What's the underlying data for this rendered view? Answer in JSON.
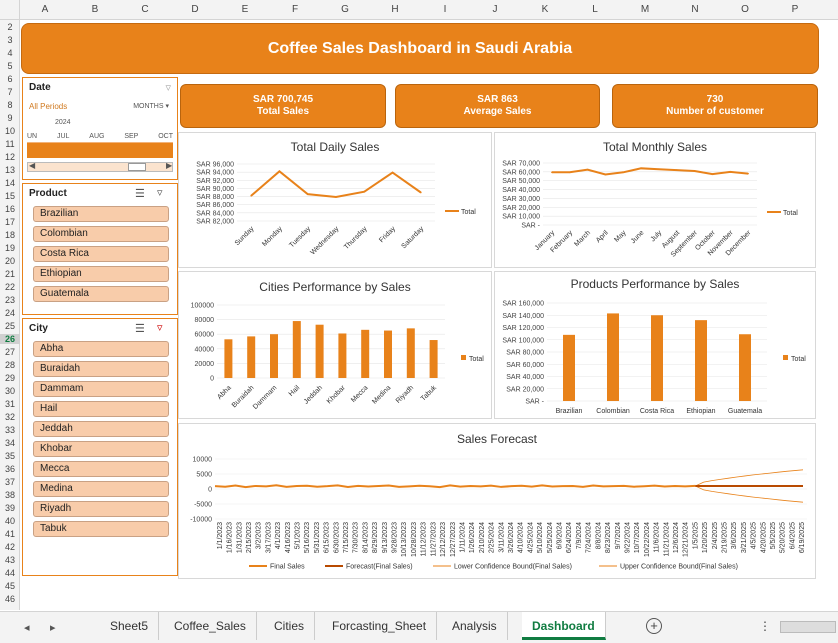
{
  "columns": [
    "A",
    "B",
    "C",
    "D",
    "E",
    "F",
    "G",
    "H",
    "I",
    "J",
    "K",
    "L",
    "M",
    "N",
    "O",
    "P"
  ],
  "rows": [
    "2",
    "3",
    "4",
    "5",
    "6",
    "7",
    "8",
    "9",
    "10",
    "11",
    "12",
    "13",
    "14",
    "15",
    "16",
    "17",
    "18",
    "19",
    "20",
    "21",
    "22",
    "23",
    "24",
    "25",
    "26",
    "27",
    "28",
    "29",
    "30",
    "31",
    "32",
    "33",
    "34",
    "35",
    "36",
    "37",
    "38",
    "39",
    "40",
    "41",
    "42",
    "43",
    "44",
    "45",
    "46"
  ],
  "selected_row": "26",
  "banner": {
    "title": "Coffee Sales Dashboard in Saudi Arabia"
  },
  "date_slicer": {
    "header": "Date",
    "period": "All Periods",
    "granularity": "MONTHS",
    "year": "2024",
    "months": [
      "UN",
      "JUL",
      "AUG",
      "SEP",
      "OCT"
    ]
  },
  "product_slicer": {
    "header": "Product",
    "items": [
      "Brazilian",
      "Colombian",
      "Costa Rica",
      "Ethiopian",
      "Guatemala"
    ]
  },
  "city_slicer": {
    "header": "City",
    "items": [
      "Abha",
      "Buraidah",
      "Dammam",
      "Hail",
      "Jeddah",
      "Khobar",
      "Mecca",
      "Medina",
      "Riyadh",
      "Tabuk"
    ]
  },
  "kpis": [
    {
      "value": "SAR 700,745",
      "label": "Total Sales"
    },
    {
      "value": "SAR 863",
      "label": "Average Sales"
    },
    {
      "value": "730",
      "label": "Number of customer"
    }
  ],
  "colors": {
    "accent": "#e8821a",
    "slicer_button": "#f8ccaa",
    "active_tab": "#107c41"
  },
  "chart_data": [
    {
      "id": "daily",
      "type": "line",
      "title": "Total Daily Sales",
      "categories": [
        "Sunday",
        "Monday",
        "Tuesday",
        "Wednesday",
        "Thursday",
        "Friday",
        "Saturday"
      ],
      "series": [
        {
          "name": "Total",
          "values": [
            88200,
            94200,
            88600,
            87900,
            89200,
            93900,
            89000
          ]
        }
      ],
      "ylim": [
        82000,
        96000
      ],
      "yticks": [
        82000,
        84000,
        86000,
        88000,
        90000,
        92000,
        94000,
        96000
      ],
      "ytick_labels": [
        "SAR 82,000",
        "SAR 84,000",
        "SAR 86,000",
        "SAR 88,000",
        "SAR 90,000",
        "SAR 92,000",
        "SAR 94,000",
        "SAR 96,000"
      ],
      "legend": "right"
    },
    {
      "id": "monthly",
      "type": "line",
      "title": "Total Monthly Sales",
      "categories": [
        "January",
        "February",
        "March",
        "April",
        "May",
        "June",
        "July",
        "August",
        "September",
        "October",
        "November",
        "December"
      ],
      "series": [
        {
          "name": "Total",
          "values": [
            59500,
            59500,
            62500,
            57000,
            59500,
            64000,
            63000,
            62000,
            61000,
            57500,
            60000,
            58000
          ]
        }
      ],
      "ylim": [
        0,
        70000
      ],
      "yticks": [
        0,
        10000,
        20000,
        30000,
        40000,
        50000,
        60000,
        70000
      ],
      "ytick_labels": [
        "SAR -",
        "SAR 10,000",
        "SAR 20,000",
        "SAR 30,000",
        "SAR 40,000",
        "SAR 50,000",
        "SAR 60,000",
        "SAR 70,000"
      ],
      "legend": "right"
    },
    {
      "id": "cities",
      "type": "bar",
      "title": "Cities Performance by Sales",
      "categories": [
        "Abha",
        "Buraidah",
        "Dammam",
        "Hail",
        "Jeddah",
        "Khobar",
        "Mecca",
        "Medina",
        "Riyadh",
        "Tabuk"
      ],
      "series": [
        {
          "name": "Total",
          "values": [
            53000,
            57000,
            60000,
            78000,
            73000,
            61000,
            66000,
            65000,
            68000,
            52000
          ]
        }
      ],
      "ylim": [
        0,
        100000
      ],
      "yticks": [
        0,
        20000,
        40000,
        60000,
        80000,
        100000
      ],
      "ytick_labels": [
        "0",
        "20000",
        "40000",
        "60000",
        "80000",
        "100000"
      ],
      "legend": "right"
    },
    {
      "id": "products",
      "type": "bar",
      "title": "Products Performance by Sales",
      "categories": [
        "Brazilian",
        "Colombian",
        "Costa Rica",
        "Ethiopian",
        "Guatemala"
      ],
      "series": [
        {
          "name": "Total",
          "values": [
            108000,
            143000,
            140000,
            132000,
            109000
          ]
        }
      ],
      "ylim": [
        0,
        160000
      ],
      "yticks": [
        0,
        20000,
        40000,
        60000,
        80000,
        100000,
        120000,
        140000,
        160000
      ],
      "ytick_labels": [
        "SAR -",
        "SAR 20,000",
        "SAR 40,000",
        "SAR 60,000",
        "SAR 80,000",
        "SAR 100,000",
        "SAR 120,000",
        "SAR 140,000",
        "SAR 160,000"
      ],
      "legend": "right"
    },
    {
      "id": "forecast",
      "type": "line",
      "title": "Sales Forecast",
      "x_labels": [
        "1/1/2023",
        "1/16/2023",
        "1/31/2023",
        "2/15/2023",
        "3/2/2023",
        "3/17/2023",
        "4/1/2023",
        "4/16/2023",
        "5/1/2023",
        "5/16/2023",
        "5/31/2023",
        "6/15/2023",
        "6/30/2023",
        "7/15/2023",
        "7/30/2023",
        "8/14/2023",
        "8/29/2023",
        "9/13/2023",
        "9/28/2023",
        "10/13/2023",
        "10/28/2023",
        "11/12/2023",
        "11/27/2023",
        "12/12/2023",
        "12/27/2023",
        "1/11/2024",
        "1/26/2024",
        "2/10/2024",
        "2/25/2024",
        "3/11/2024",
        "3/26/2024",
        "4/10/2024",
        "4/25/2024",
        "5/10/2024",
        "5/25/2024",
        "6/9/2024",
        "6/24/2024",
        "7/9/2024",
        "7/24/2024",
        "8/8/2024",
        "8/23/2024",
        "9/7/2024",
        "9/22/2024",
        "10/7/2024",
        "10/22/2024",
        "11/6/2024",
        "11/21/2024",
        "12/6/2024",
        "12/21/2024",
        "1/5/2025",
        "1/20/2025",
        "2/4/2025",
        "2/19/2025",
        "3/6/2025",
        "3/21/2025",
        "4/5/2025",
        "4/20/2025",
        "5/5/2025",
        "5/20/2025",
        "6/4/2025",
        "6/19/2025"
      ],
      "series": [
        {
          "name": "Final Sales",
          "values": [
            960,
            740,
            1180,
            620,
            1020,
            880,
            1240,
            700,
            980,
            1100,
            760,
            940,
            1200,
            660,
            1050,
            820,
            990,
            1150,
            720,
            870,
            1080,
            930,
            640,
            1210,
            800,
            1010,
            890,
            1130,
            690,
            960,
            1070,
            780,
            1190,
            850,
            940,
            1000,
            730,
            1160,
            880,
            970,
            1040,
            760,
            910,
            1120,
            820,
            990,
            870,
            1060
          ]
        },
        {
          "name": "Forecast(Final Sales)",
          "values": [
            1000,
            1000,
            1000,
            1000,
            1000,
            1000,
            1000,
            1000,
            1000,
            1000,
            1000,
            1000,
            1000,
            1000
          ]
        },
        {
          "name": "Lower Confidence Bound(Final Sales)",
          "values": [
            1000,
            -300,
            -800,
            -1200,
            -1600,
            -2000,
            -2350,
            -2700,
            -3000,
            -3300,
            -3600,
            -3900,
            -4150,
            -4400
          ]
        },
        {
          "name": "Upper Confidence Bound(Final Sales)",
          "values": [
            1000,
            2300,
            2800,
            3200,
            3600,
            4000,
            4350,
            4700,
            5000,
            5300,
            5600,
            5900,
            6150,
            6400
          ]
        }
      ],
      "ylim": [
        -10000,
        10000
      ],
      "yticks": [
        -10000,
        -5000,
        0,
        5000,
        10000
      ],
      "ytick_labels": [
        "-10000",
        "-5000",
        "0",
        "5000",
        "10000"
      ],
      "legend": "bottom"
    }
  ],
  "tabs": [
    "Sheet5",
    "Coffee_Sales",
    "Cities",
    "Forcasting_Sheet",
    "Analysis",
    "Dashboard"
  ],
  "active_tab": "Dashboard",
  "add_sheet_symbol": "+",
  "more_symbol": "⋮",
  "nav_prev": "◂",
  "nav_next": "▸"
}
